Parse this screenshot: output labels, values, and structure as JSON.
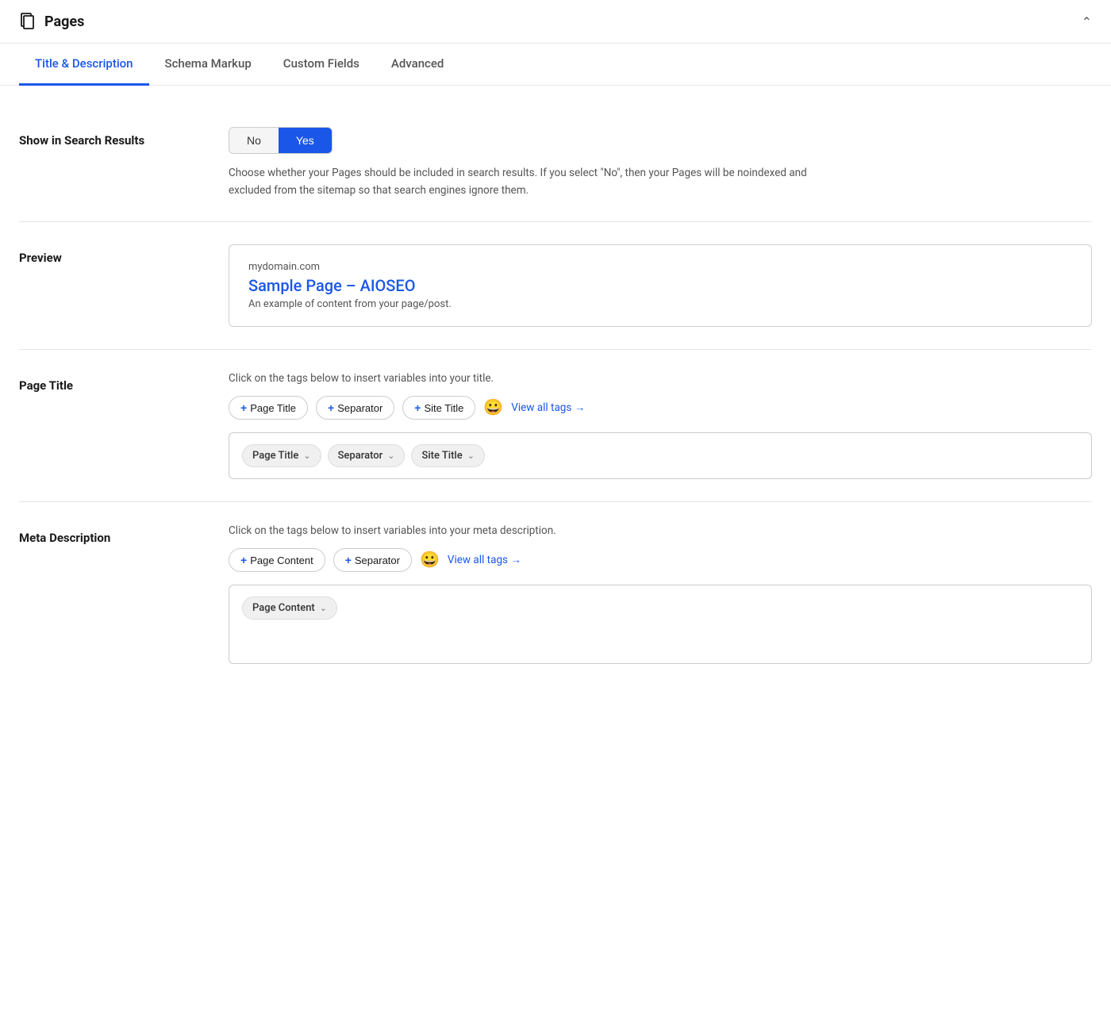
{
  "header": {
    "title": "Pages",
    "icon_label": "pages-icon",
    "chevron_label": "collapse"
  },
  "tabs": [
    {
      "id": "title-description",
      "label": "Title & Description",
      "active": true
    },
    {
      "id": "schema-markup",
      "label": "Schema Markup",
      "active": false
    },
    {
      "id": "custom-fields",
      "label": "Custom Fields",
      "active": false
    },
    {
      "id": "advanced",
      "label": "Advanced",
      "active": false
    }
  ],
  "show_in_search_results": {
    "label": "Show in Search Results",
    "no_label": "No",
    "yes_label": "Yes",
    "active": "yes",
    "description": "Choose whether your Pages should be included in search results. If you select \"No\", then your Pages will be noindexed and excluded from the sitemap so that search engines ignore them."
  },
  "preview": {
    "label": "Preview",
    "domain": "mydomain.com",
    "title": "Sample Page – AIOSEO",
    "description": "An example of content from your page/post."
  },
  "page_title": {
    "label": "Page Title",
    "insert_text": "Click on the tags below to insert variables into your title.",
    "tag_buttons": [
      {
        "id": "page-title-tag",
        "label": "Page Title"
      },
      {
        "id": "separator-tag",
        "label": "Separator"
      },
      {
        "id": "site-title-tag",
        "label": "Site Title"
      }
    ],
    "emoji_label": "emoji-icon",
    "view_all_label": "View all tags →",
    "chips": [
      {
        "id": "page-title-chip",
        "label": "Page Title"
      },
      {
        "id": "separator-chip",
        "label": "Separator"
      },
      {
        "id": "site-title-chip",
        "label": "Site Title"
      }
    ]
  },
  "meta_description": {
    "label": "Meta Description",
    "insert_text": "Click on the tags below to insert variables into your meta description.",
    "tag_buttons": [
      {
        "id": "page-content-tag",
        "label": "Page Content"
      },
      {
        "id": "separator-tag-meta",
        "label": "Separator"
      }
    ],
    "emoji_label": "emoji-icon-meta",
    "view_all_label": "View all tags →",
    "chips": [
      {
        "id": "page-content-chip",
        "label": "Page Content"
      }
    ]
  }
}
